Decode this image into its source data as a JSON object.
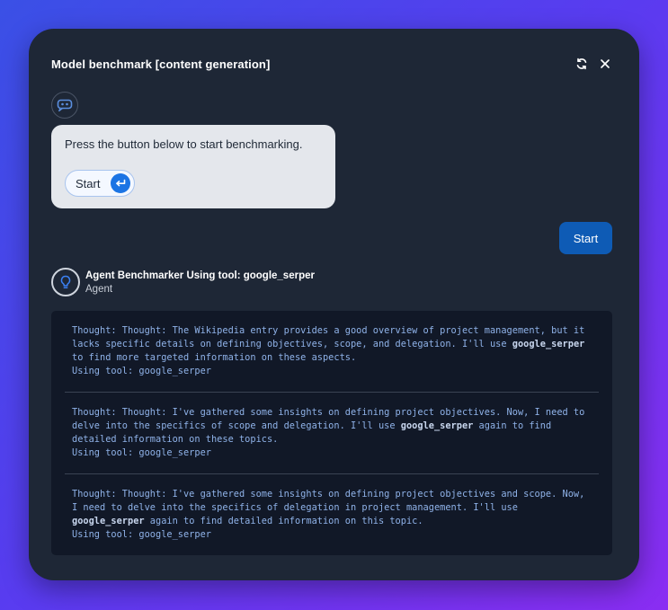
{
  "dialog": {
    "title": "Model benchmark [content generation]",
    "refresh_icon": "refresh-icon",
    "close_icon": "close-icon"
  },
  "bot": {
    "avatar_icon": "chat-bot-icon",
    "message": "Press the button below to start benchmarking.",
    "start_label": "Start",
    "enter_icon": "enter-return-icon"
  },
  "user": {
    "message": "Start"
  },
  "agent": {
    "avatar_icon": "lightbulb-icon",
    "name": "Agent Benchmarker Using tool: google_serper",
    "role": "Agent"
  },
  "log": {
    "entries": [
      {
        "before": "Thought: Thought: The Wikipedia entry provides a good overview of project management, but it lacks specific details on defining objectives, scope, and delegation. I'll use ",
        "tool": "google_serper",
        "after": " to find more targeted information on these aspects.",
        "using": "Using tool: google_serper"
      },
      {
        "before": "Thought: Thought: I've gathered some insights on defining project objectives. Now, I need to delve into the specifics of scope and delegation. I'll use ",
        "tool": "google_serper",
        "after": " again to find detailed information on these topics.",
        "using": "Using tool: google_serper"
      },
      {
        "before": "Thought: Thought: I've gathered some insights on defining project objectives and scope. Now, I need to delve into the specifics of delegation in project management. I'll use ",
        "tool": "google_serper",
        "after": " again to find detailed information on this topic.",
        "using": "Using tool: google_serper"
      }
    ]
  },
  "colors": {
    "panel": "#1e2736",
    "user_bubble": "#0e5bb5",
    "accent": "#1b74e4",
    "log_text": "#8fb2e8"
  }
}
